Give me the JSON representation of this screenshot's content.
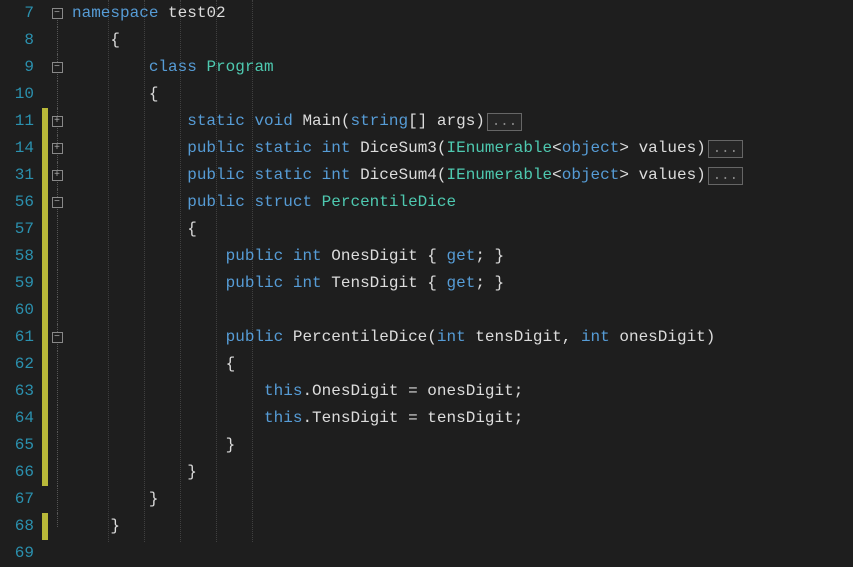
{
  "lines": [
    {
      "num": "7",
      "fold": "minus",
      "changed": false,
      "indent": 0,
      "tokens": [
        [
          "kw",
          "namespace"
        ],
        [
          "",
          ""
        ],
        [
          "var",
          "test02"
        ]
      ]
    },
    {
      "num": "8",
      "fold": "line",
      "changed": false,
      "indent": 1,
      "tokens": [
        [
          "punct",
          "{"
        ]
      ]
    },
    {
      "num": "9",
      "fold": "minus",
      "changed": false,
      "indent": 2,
      "tokens": [
        [
          "kw",
          "class"
        ],
        [
          "",
          ""
        ],
        [
          "type",
          "Program"
        ]
      ]
    },
    {
      "num": "10",
      "fold": "line",
      "changed": false,
      "indent": 2,
      "tokens": [
        [
          "punct",
          "{"
        ]
      ]
    },
    {
      "num": "11",
      "fold": "plus",
      "changed": true,
      "indent": 3,
      "tokens": [
        [
          "kw",
          "static"
        ],
        [
          "",
          ""
        ],
        [
          "kw",
          "void"
        ],
        [
          "",
          ""
        ],
        [
          "var",
          "Main"
        ],
        [
          "punct",
          "("
        ],
        [
          "kw",
          "string"
        ],
        [
          "punct",
          "[]"
        ],
        [
          "",
          ""
        ],
        [
          "var",
          "args"
        ],
        [
          "punct",
          ")"
        ]
      ],
      "collapsed": "..."
    },
    {
      "num": "14",
      "fold": "plus",
      "changed": true,
      "indent": 3,
      "tokens": [
        [
          "kw",
          "public"
        ],
        [
          "",
          ""
        ],
        [
          "kw",
          "static"
        ],
        [
          "",
          ""
        ],
        [
          "kw",
          "int"
        ],
        [
          "",
          ""
        ],
        [
          "var",
          "DiceSum3"
        ],
        [
          "punct",
          "("
        ],
        [
          "type",
          "IEnumerable"
        ],
        [
          "punct",
          "<"
        ],
        [
          "kw",
          "object"
        ],
        [
          "punct",
          ">"
        ],
        [
          "",
          ""
        ],
        [
          "var",
          "values"
        ],
        [
          "punct",
          ")"
        ]
      ],
      "collapsed": "..."
    },
    {
      "num": "31",
      "fold": "plus",
      "changed": true,
      "indent": 3,
      "tokens": [
        [
          "kw",
          "public"
        ],
        [
          "",
          ""
        ],
        [
          "kw",
          "static"
        ],
        [
          "",
          ""
        ],
        [
          "kw",
          "int"
        ],
        [
          "",
          ""
        ],
        [
          "var",
          "DiceSum4"
        ],
        [
          "punct",
          "("
        ],
        [
          "type",
          "IEnumerable"
        ],
        [
          "punct",
          "<"
        ],
        [
          "kw",
          "object"
        ],
        [
          "punct",
          ">"
        ],
        [
          "",
          ""
        ],
        [
          "var",
          "values"
        ],
        [
          "punct",
          ")"
        ]
      ],
      "collapsed": "..."
    },
    {
      "num": "56",
      "fold": "minus",
      "changed": true,
      "indent": 3,
      "tokens": [
        [
          "kw",
          "public"
        ],
        [
          "",
          ""
        ],
        [
          "kw",
          "struct"
        ],
        [
          "",
          ""
        ],
        [
          "type",
          "PercentileDice"
        ]
      ]
    },
    {
      "num": "57",
      "fold": "line",
      "changed": true,
      "indent": 3,
      "tokens": [
        [
          "punct",
          "{"
        ]
      ]
    },
    {
      "num": "58",
      "fold": "line",
      "changed": true,
      "indent": 4,
      "tokens": [
        [
          "kw",
          "public"
        ],
        [
          "",
          ""
        ],
        [
          "kw",
          "int"
        ],
        [
          "",
          ""
        ],
        [
          "var",
          "OnesDigit"
        ],
        [
          "",
          ""
        ],
        [
          "punct",
          "{ "
        ],
        [
          "kw",
          "get"
        ],
        [
          "punct",
          "; }"
        ]
      ]
    },
    {
      "num": "59",
      "fold": "line",
      "changed": true,
      "indent": 4,
      "tokens": [
        [
          "kw",
          "public"
        ],
        [
          "",
          ""
        ],
        [
          "kw",
          "int"
        ],
        [
          "",
          ""
        ],
        [
          "var",
          "TensDigit"
        ],
        [
          "",
          ""
        ],
        [
          "punct",
          "{ "
        ],
        [
          "kw",
          "get"
        ],
        [
          "punct",
          "; }"
        ]
      ]
    },
    {
      "num": "60",
      "fold": "line",
      "changed": true,
      "indent": 0,
      "tokens": []
    },
    {
      "num": "61",
      "fold": "minus",
      "changed": true,
      "indent": 4,
      "tokens": [
        [
          "kw",
          "public"
        ],
        [
          "",
          ""
        ],
        [
          "var",
          "PercentileDice"
        ],
        [
          "punct",
          "("
        ],
        [
          "kw",
          "int"
        ],
        [
          "",
          ""
        ],
        [
          "var",
          "tensDigit"
        ],
        [
          "punct",
          ","
        ],
        [
          "",
          ""
        ],
        [
          "kw",
          "int"
        ],
        [
          "",
          ""
        ],
        [
          "var",
          "onesDigit"
        ],
        [
          "punct",
          ")"
        ]
      ]
    },
    {
      "num": "62",
      "fold": "line",
      "changed": true,
      "indent": 4,
      "tokens": [
        [
          "punct",
          "{"
        ]
      ]
    },
    {
      "num": "63",
      "fold": "line",
      "changed": true,
      "indent": 5,
      "tokens": [
        [
          "this",
          "this"
        ],
        [
          "punct",
          "."
        ],
        [
          "var",
          "OnesDigit"
        ],
        [
          "",
          ""
        ],
        [
          "punct",
          "="
        ],
        [
          "",
          ""
        ],
        [
          "var",
          "onesDigit"
        ],
        [
          "punct",
          ";"
        ]
      ]
    },
    {
      "num": "64",
      "fold": "line",
      "changed": true,
      "indent": 5,
      "tokens": [
        [
          "this",
          "this"
        ],
        [
          "punct",
          "."
        ],
        [
          "var",
          "TensDigit"
        ],
        [
          "",
          ""
        ],
        [
          "punct",
          "="
        ],
        [
          "",
          ""
        ],
        [
          "var",
          "tensDigit"
        ],
        [
          "punct",
          ";"
        ]
      ]
    },
    {
      "num": "65",
      "fold": "line",
      "changed": true,
      "indent": 4,
      "tokens": [
        [
          "punct",
          "}"
        ]
      ]
    },
    {
      "num": "66",
      "fold": "line",
      "changed": true,
      "indent": 3,
      "tokens": [
        [
          "punct",
          "}"
        ]
      ]
    },
    {
      "num": "67",
      "fold": "line",
      "changed": false,
      "indent": 2,
      "tokens": [
        [
          "punct",
          "}"
        ]
      ]
    },
    {
      "num": "68",
      "fold": "end",
      "changed": true,
      "indent": 1,
      "tokens": [
        [
          "punct",
          "}"
        ]
      ]
    },
    {
      "num": "69",
      "fold": "",
      "changed": false,
      "indent": 0,
      "tokens": []
    }
  ],
  "indent_unit": "    ",
  "collapsed_label": "..."
}
